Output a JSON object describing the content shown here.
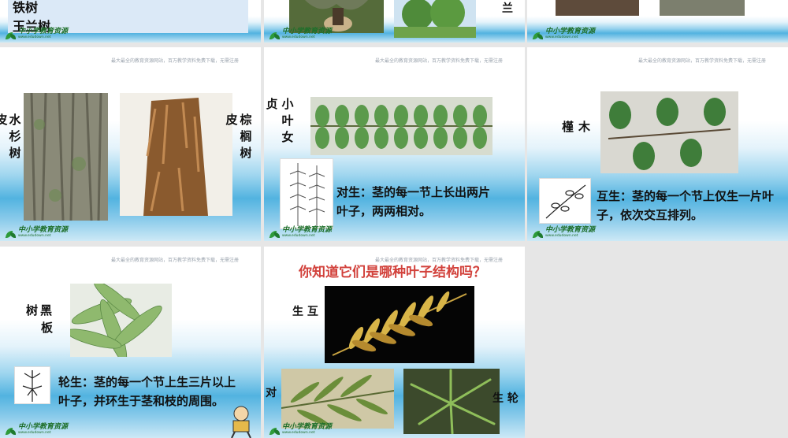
{
  "watermark": {
    "tagline": "最大最全的教育资源网站，百万教学资料免费下载，无需注册",
    "logo_cn": "中小学教育资源",
    "logo_url": "www.edudown.net"
  },
  "slide1": {
    "items": [
      "铁树",
      "玉兰树"
    ]
  },
  "slide2": {
    "label": "兰"
  },
  "slide4": {
    "left_label": "水杉树",
    "left_fragment": "皮",
    "right_label_a": "皮",
    "right_label_b": "棕榈树"
  },
  "slide5": {
    "left_fragment": "贞",
    "label": "小叶女",
    "caption": "对生：茎的每一节上长出两片叶子，两两相对。"
  },
  "slide6": {
    "label": "槿木",
    "caption": "互生：茎的每一个节上仅生一片叶子，依次交互排列。"
  },
  "slide7": {
    "label_a": "树黑",
    "label_b": "板",
    "caption": "轮生：茎的每一个节上生三片以上叶子，并环生于茎和枝的周围。"
  },
  "slide8": {
    "title": "你知道它们是哪种叶子结构吗？",
    "label_top": "生 互",
    "label_left": "对",
    "label_right": "生 轮"
  },
  "colors": {
    "accent_title": "#d2423c",
    "logo_green": "#1e6f2a"
  }
}
